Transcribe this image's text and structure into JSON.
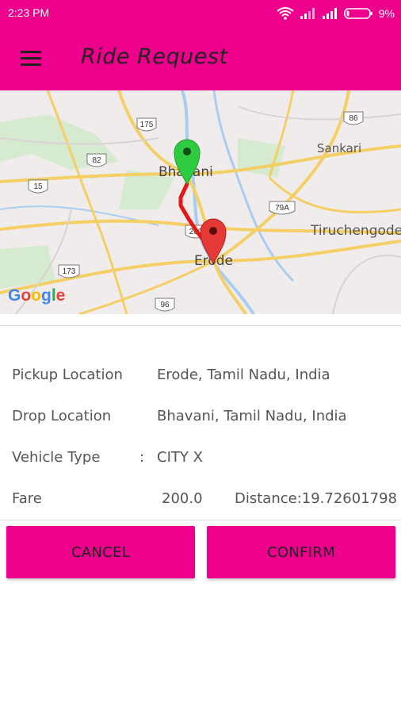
{
  "status_bar": {
    "time": "2:23 PM",
    "battery": "9%"
  },
  "app_bar": {
    "title": "Ride Request",
    "menu_icon": "hamburger-menu-icon"
  },
  "map": {
    "places": [
      "Bhavani",
      "Sankari",
      "Tiruchengode",
      "Erode"
    ],
    "route_shields": [
      "175",
      "86",
      "82",
      "15",
      "79A",
      "200",
      "173",
      "96"
    ],
    "attribution": "Google",
    "pickup_marker_color": "#e53935",
    "drop_marker_color": "#2ecc40",
    "route_color": "#e31919"
  },
  "details": {
    "pickup": {
      "label": "Pickup Location",
      "value": "Erode, Tamil Nadu, India"
    },
    "drop": {
      "label": "Drop Location",
      "value": "Bhavani, Tamil Nadu, India"
    },
    "vehicle": {
      "label": "Vehicle Type",
      "colon": ":",
      "value": "CITY X"
    },
    "fare": {
      "label": "Fare",
      "value": "200.0",
      "distance": "Distance:19.72601798"
    }
  },
  "actions": {
    "cancel": "CANCEL",
    "confirm": "CONFIRM"
  },
  "colors": {
    "accent": "#ec008c"
  }
}
